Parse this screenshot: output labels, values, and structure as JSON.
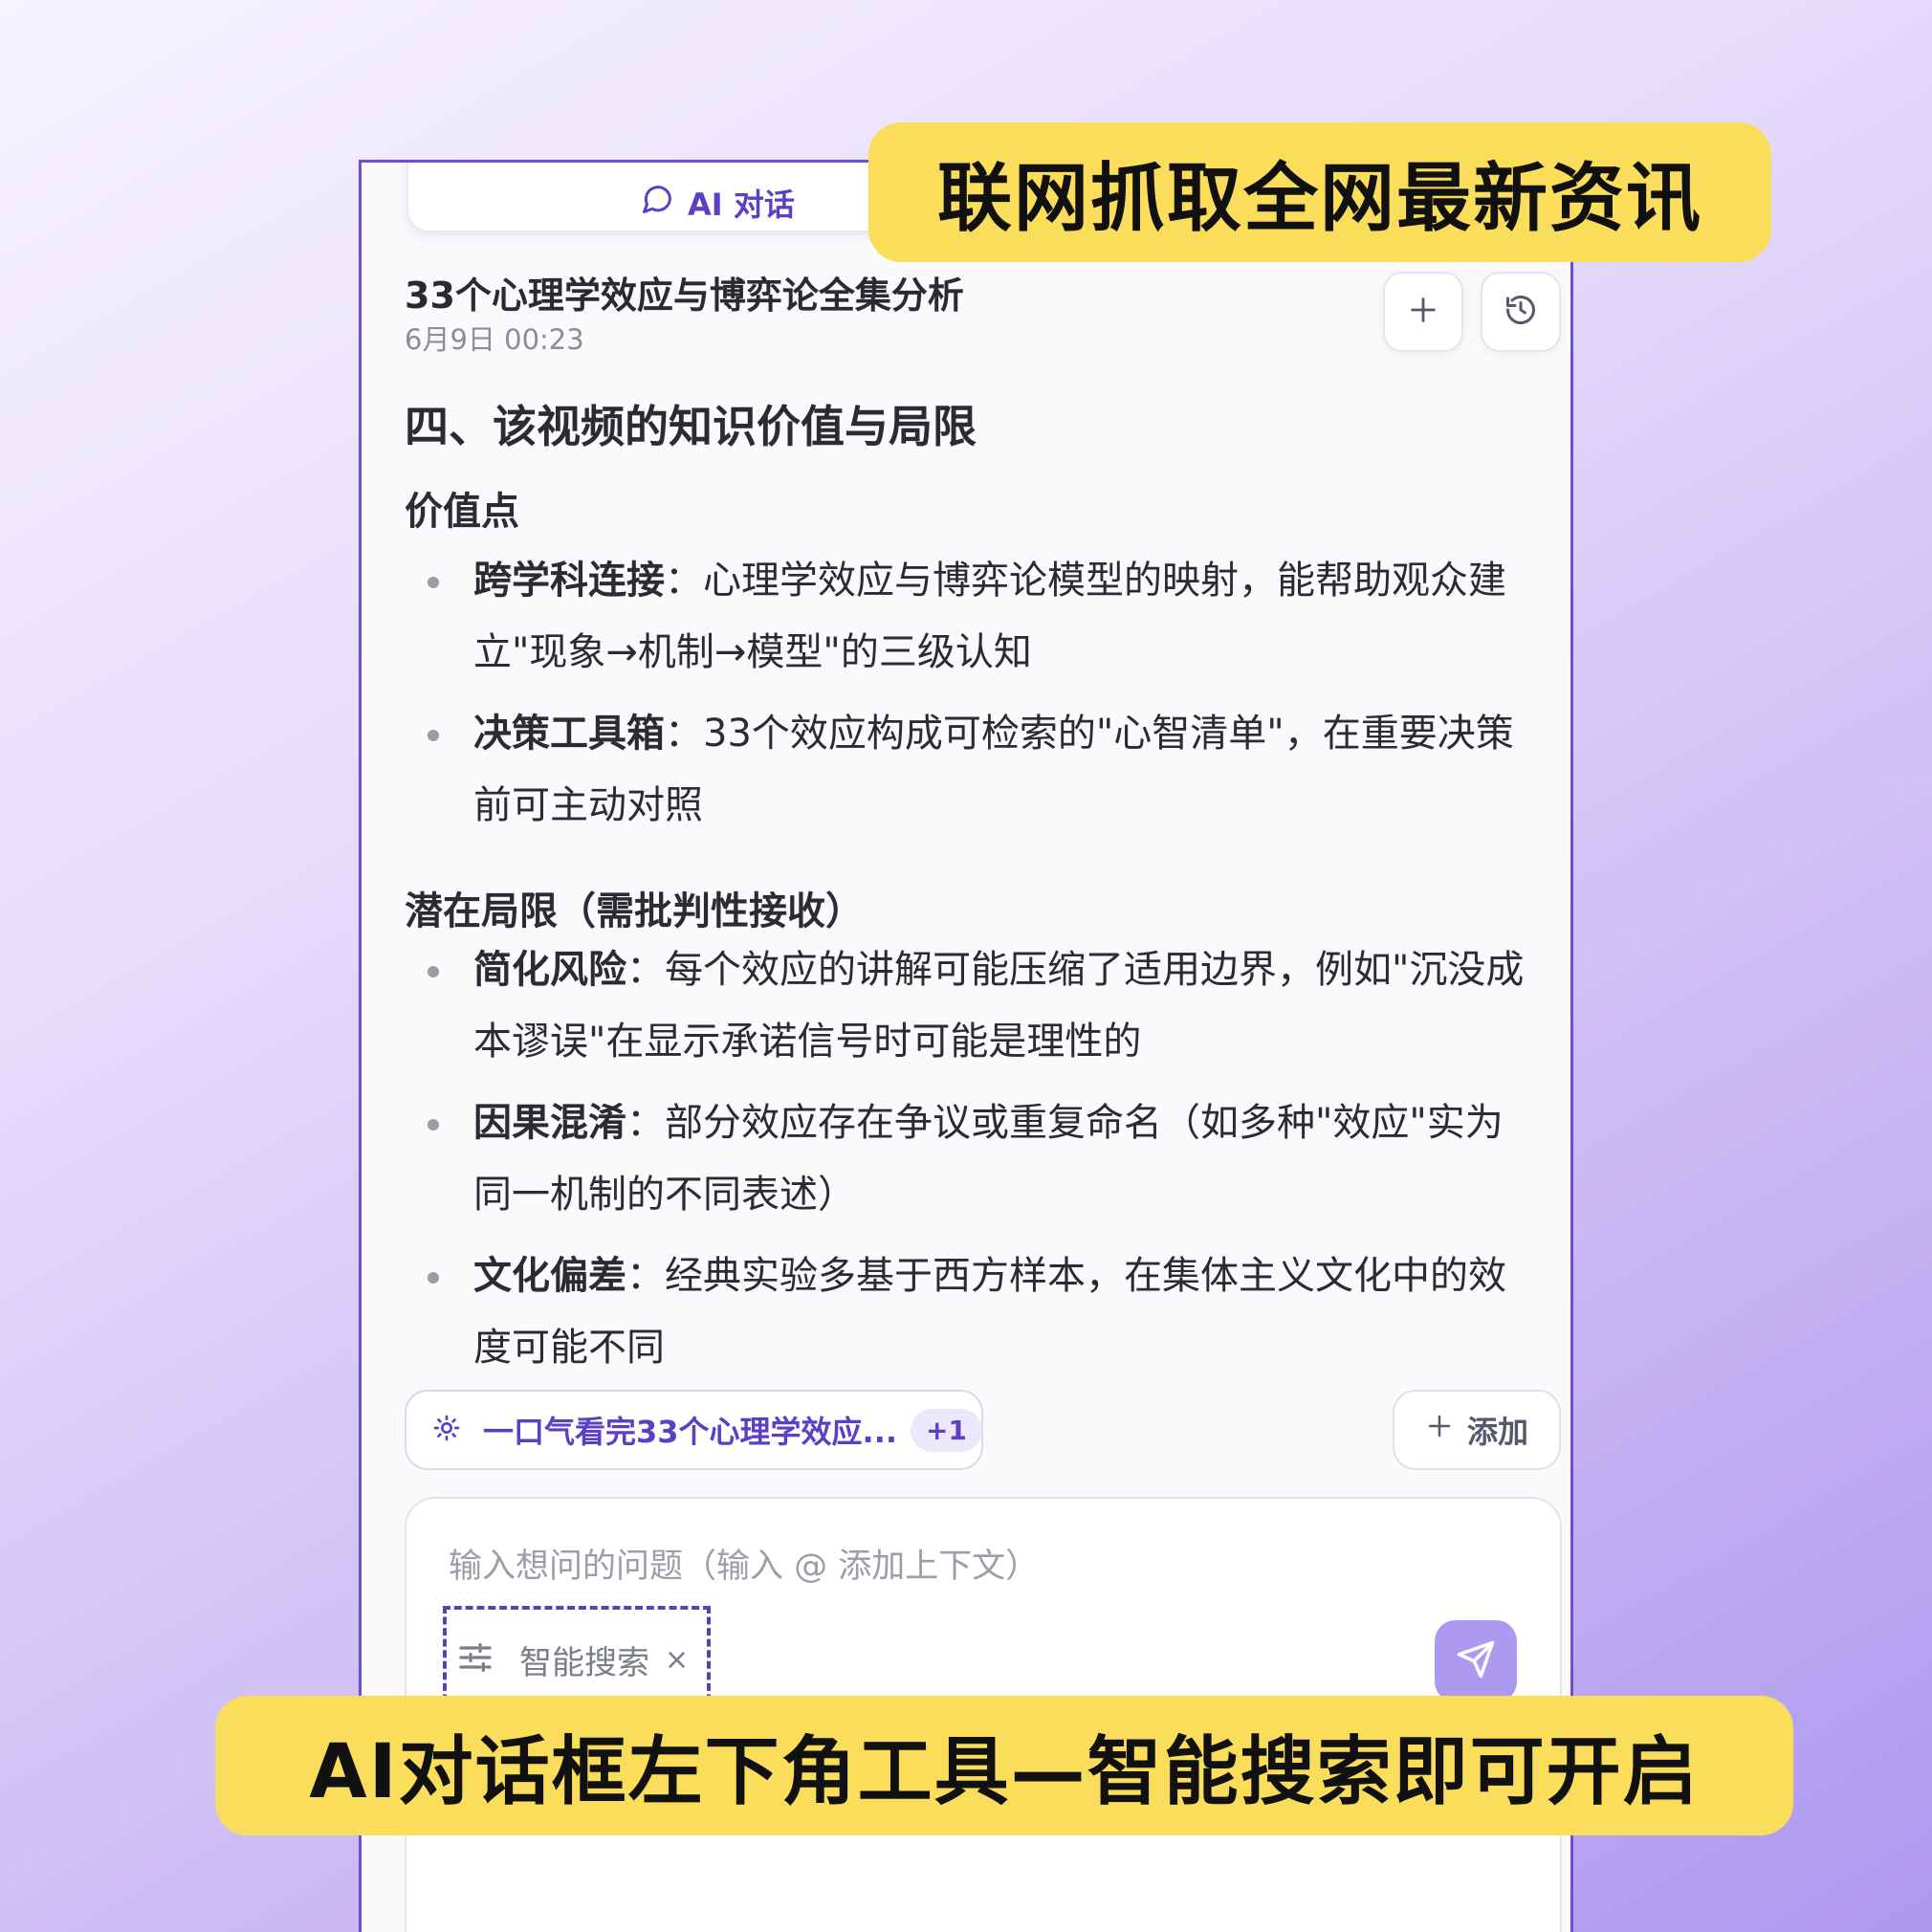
{
  "header": {
    "tab_label": "AI 对话",
    "title": "33个心理学效应与博弈论全集分析",
    "timestamp": "6月9日 00:23"
  },
  "content": {
    "heading": "四、该视频的知识价值与局限",
    "value_title": "价值点",
    "value_items": [
      {
        "term": "跨学科连接",
        "text": "：心理学效应与博弈论模型的映射，能帮助观众建立\"现象→机制→模型\"的三级认知"
      },
      {
        "term": "决策工具箱",
        "text": "：33个效应构成可检索的\"心智清单\"，在重要决策前可主动对照"
      }
    ],
    "limit_title": "潜在局限（需批判性接收）",
    "limit_items": [
      {
        "term": "简化风险",
        "text": "：每个效应的讲解可能压缩了适用边界，例如\"沉没成本谬误\"在显示承诺信号时可能是理性的"
      },
      {
        "term": "因果混淆",
        "text": "：部分效应存在争议或重复命名（如多种\"效应\"实为同一机制的不同表述）"
      },
      {
        "term": "文化偏差",
        "text": "：经典实验多基于西方样本，在集体主义文化中的效度可能不同"
      }
    ]
  },
  "context": {
    "chip_label": "一口气看完33个心理学效应...",
    "chip_badge": "+1",
    "add_label": "添加"
  },
  "input": {
    "placeholder": "输入想问的问题（输入 @ 添加上下文）",
    "tool_label": "智能搜索",
    "tool_close": "×"
  },
  "banners": {
    "top": "联网抓取全网最新资讯",
    "bottom": "AI对话框左下角工具—智能搜索即可开启"
  },
  "colors": {
    "accent": "#5b3fc4",
    "banner": "#fbdd5c",
    "send_button": "#ab9af0"
  }
}
